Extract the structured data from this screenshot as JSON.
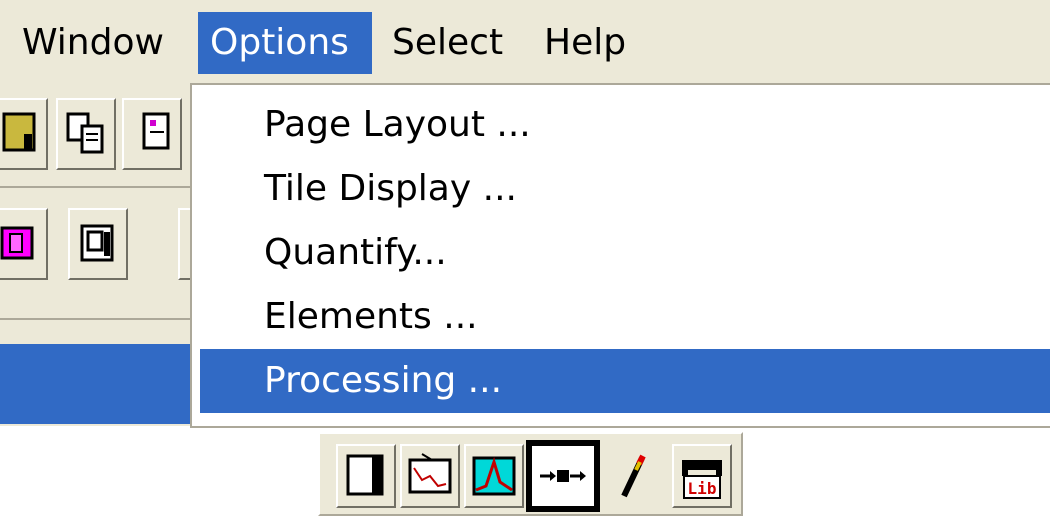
{
  "menubar": {
    "items": [
      {
        "label": "Window"
      },
      {
        "label": "Options"
      },
      {
        "label": "Select"
      },
      {
        "label": "Help"
      }
    ],
    "active_index": 1,
    "accent_color": "#316ac5"
  },
  "options_menu": {
    "items": [
      {
        "label": "Page Layout ..."
      },
      {
        "label": "Tile Display ..."
      },
      {
        "label": "Quantify..."
      },
      {
        "label": "Elements ..."
      },
      {
        "label": "Processing ..."
      }
    ],
    "selected_index": 4
  },
  "toolbar_top_left": {
    "icons": [
      "save-icon",
      "copy-icon",
      "paste-icon",
      "layers-icon",
      "overlay-icon"
    ]
  },
  "bottom_toolbar": {
    "icons": [
      "panel-icon",
      "monitor-graph-icon",
      "spectrum-icon",
      "process-arrow-icon",
      "pencil-icon",
      "library-icon"
    ],
    "pressed_index": 3,
    "library_label": "Lib"
  }
}
